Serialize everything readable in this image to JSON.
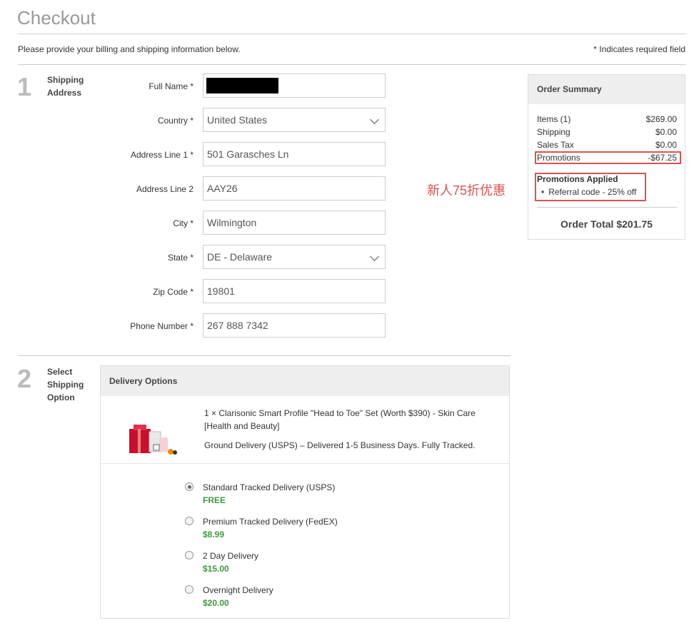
{
  "page": {
    "title": "Checkout",
    "intro": "Please provide your billing and shipping information below.",
    "required_note": "* Indicates required field"
  },
  "step1": {
    "number": "1",
    "label_line1": "Shipping",
    "label_line2": "Address",
    "fields": {
      "full_name": {
        "label": "Full Name *",
        "value": ""
      },
      "country": {
        "label": "Country *",
        "value": "United States"
      },
      "address1": {
        "label": "Address Line 1 *",
        "value": "501 Garasches Ln"
      },
      "address2": {
        "label": "Address Line 2",
        "value": "AAY26"
      },
      "city": {
        "label": "City *",
        "value": "Wilmington"
      },
      "state": {
        "label": "State *",
        "value": "DE - Delaware"
      },
      "zip": {
        "label": "Zip Code *",
        "value": "19801"
      },
      "phone": {
        "label": "Phone Number *",
        "value": "267 888 7342"
      }
    }
  },
  "annotation": {
    "promo_note": "新人75折优惠",
    "color": "#d9534f"
  },
  "summary": {
    "title": "Order Summary",
    "items_label": "Items (1)",
    "items_value": "$269.00",
    "shipping_label": "Shipping",
    "shipping_value": "$0.00",
    "tax_label": "Sales Tax",
    "tax_value": "$0.00",
    "promotions_label": "Promotions",
    "promotions_value": "-$67.25",
    "promos_applied_title": "Promotions Applied",
    "promo_item": "Referral code - 25% off",
    "order_total": "Order Total $201.75"
  },
  "step2": {
    "number": "2",
    "label_line1": "Select",
    "label_line2": "Shipping",
    "label_line3": "Option",
    "delivery_title": "Delivery Options",
    "product_line1": "1 × Clarisonic Smart Profile \"Head to Toe\" Set (Worth $390) - Skin Care",
    "product_line2": "[Health and Beauty]",
    "product_delivery": "Ground Delivery (USPS) – Delivered 1-5 Business Days. Fully Tracked.",
    "options": [
      {
        "name": "Standard Tracked Delivery (USPS)",
        "price": "FREE",
        "selected": true
      },
      {
        "name": "Premium Tracked Delivery (FedEX)",
        "price": "$8.99",
        "selected": false
      },
      {
        "name": "2 Day Delivery",
        "price": "$15.00",
        "selected": false
      },
      {
        "name": "Overnight Delivery",
        "price": "$20.00",
        "selected": false
      }
    ],
    "price_color": "#3c9a3c"
  }
}
